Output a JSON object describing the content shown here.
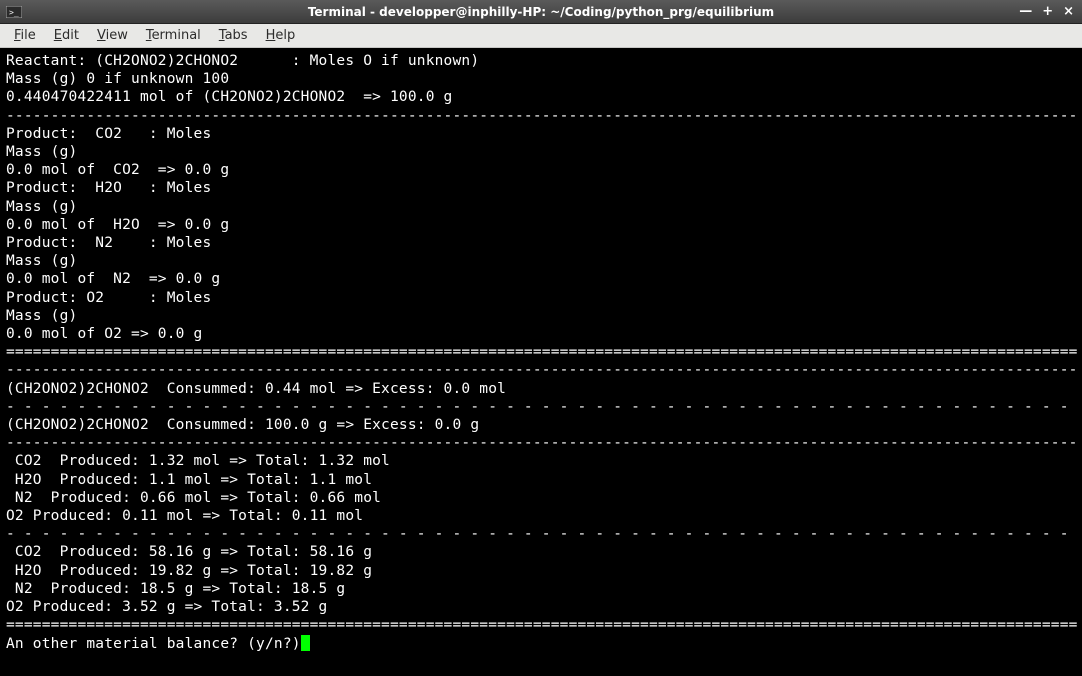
{
  "window": {
    "title": "Terminal - developper@inphilly-HP: ~/Coding/python_prg/equilibrium",
    "controls": {
      "minimize": "—",
      "maximize": "+",
      "close": "×"
    }
  },
  "menu": {
    "file": {
      "u": "F",
      "rest": "ile"
    },
    "edit": {
      "u": "E",
      "rest": "dit"
    },
    "view": {
      "u": "V",
      "rest": "iew"
    },
    "terminal": {
      "u": "T",
      "rest": "erminal"
    },
    "tabs": {
      "u": "T",
      "rest": "abs"
    },
    "help": {
      "u": "H",
      "rest": "elp"
    }
  },
  "lines": {
    "l00": "Reactant: (CH2ONO2)2CHONO2      : Moles O if unknown)",
    "l01": "Mass (g) 0 if unknown 100",
    "l02": "0.440470422411 mol of (CH2ONO2)2CHONO2  => 100.0 g",
    "l03": "------------------------------------------------------------------------------------------------------------------------",
    "l04": "Product:  CO2   : Moles",
    "l05": "Mass (g)",
    "l06": "0.0 mol of  CO2  => 0.0 g",
    "l07": "Product:  H2O   : Moles",
    "l08": "Mass (g)",
    "l09": "0.0 mol of  H2O  => 0.0 g",
    "l10": "Product:  N2    : Moles",
    "l11": "Mass (g)",
    "l12": "0.0 mol of  N2  => 0.0 g",
    "l13": "Product: O2     : Moles",
    "l14": "Mass (g)",
    "l15": "0.0 mol of O2 => 0.0 g",
    "l16": "========================================================================================================================",
    "l17": "------------------------------------------------------------------------------------------------------------------------",
    "l18": "(CH2ONO2)2CHONO2  Consummed: 0.44 mol => Excess: 0.0 mol",
    "l19": "- - - - - - - - - - - - - - - - - - - - - - - - - - - - - - - - - - - - - - - - - - - - - - - - - - - - - - - - - - - - ",
    "l20": "(CH2ONO2)2CHONO2  Consummed: 100.0 g => Excess: 0.0 g",
    "l21": "------------------------------------------------------------------------------------------------------------------------",
    "l22": " CO2  Produced: 1.32 mol => Total: 1.32 mol",
    "l23": " H2O  Produced: 1.1 mol => Total: 1.1 mol",
    "l24": " N2  Produced: 0.66 mol => Total: 0.66 mol",
    "l25": "O2 Produced: 0.11 mol => Total: 0.11 mol",
    "l26": "- - - - - - - - - - - - - - - - - - - - - - - - - - - - - - - - - - - - - - - - - - - - - - - - - - - - - - - - - - - - ",
    "l27": " CO2  Produced: 58.16 g => Total: 58.16 g",
    "l28": " H2O  Produced: 19.82 g => Total: 19.82 g",
    "l29": " N2  Produced: 18.5 g => Total: 18.5 g",
    "l30": "O2 Produced: 3.52 g => Total: 3.52 g",
    "l31": "========================================================================================================================",
    "l32": "An other material balance? (y/n?)"
  }
}
